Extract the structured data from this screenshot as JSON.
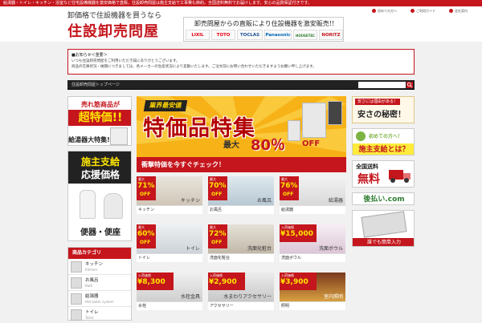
{
  "topbar": {
    "text": "給湯器・トイレ・キッチン・浴室など住宅設備機器を激安価格で直販。住設卸売問屋は施主支給で工事費も節約。全国送料無料でお届けします。安心の品質保証付きです。"
  },
  "header": {
    "tagline": "卸価格で住設機器を買うなら",
    "logo": "住設卸売問屋",
    "nav": [
      {
        "label": "初めての方へ"
      },
      {
        "label": "ご利用ガイド"
      },
      {
        "label": "会社案内"
      }
    ],
    "banner_msg": "卸売問屋からの直販により住設機器を激安販売!!",
    "brands": [
      "LIXIL",
      "TOTO",
      "TOCLAS",
      "Panasonic",
      "HOUSETEC",
      "NORITZ"
    ]
  },
  "notice": {
    "heading": "■お知らせ＜重要＞",
    "line1": "いつも住設卸売問屋をご利用いただき誠にありがとうございます。",
    "line2": "商品の在庫状況・納期につきましては、各メーカーの生産状況により変動いたします。ご注文前にお問い合わせいただきますようお願い申し上げます。"
  },
  "navbar": {
    "crumb": "住設卸売問屋トップページ",
    "search_placeholder": ""
  },
  "left_promos": {
    "p1_top": "売れ筋商品が",
    "p1_main": "超特価!!",
    "p1_sub": "給湯器大特集!",
    "p2_top": "施主支給",
    "p2_main": "応援価格",
    "p2_sub": "便器・便座"
  },
  "categories": {
    "heading": "商品カテゴリ",
    "items": [
      {
        "jp": "キッチン",
        "en": "Kitchen"
      },
      {
        "jp": "お風呂",
        "en": "Bath"
      },
      {
        "jp": "給湯器",
        "en": "Hot-water system"
      },
      {
        "jp": "トイレ",
        "en": "Toilet"
      }
    ]
  },
  "hero": {
    "badge": "業界最安値",
    "title": "特価品特集",
    "max": "最大",
    "pct": "80％",
    "off": "OFF",
    "cta": "衝撃特価を今すぐチェック！"
  },
  "tiles": [
    {
      "kicker": "最大",
      "price": "71%",
      "suffix": "OFF",
      "inlabel": "キッチン",
      "label": "キッチン"
    },
    {
      "kicker": "最大",
      "price": "70%",
      "suffix": "OFF",
      "inlabel": "お風呂",
      "label": "お風呂"
    },
    {
      "kicker": "最大",
      "price": "76%",
      "suffix": "OFF",
      "inlabel": "給湯器",
      "label": "給湯器"
    },
    {
      "kicker": "最大",
      "price": "60%",
      "suffix": "OFF",
      "inlabel": "トイレ",
      "label": "トイレ"
    },
    {
      "kicker": "最大",
      "price": "72%",
      "suffix": "OFF",
      "inlabel": "洗面化粧台",
      "label": "洗面化粧台"
    },
    {
      "kicker": "入荷価格",
      "price": "¥15,000",
      "suffix": "〜",
      "inlabel": "洗面ボウル",
      "label": "洗面ボウル"
    },
    {
      "kicker": "入荷価格",
      "price": "¥8,300",
      "suffix": "〜",
      "inlabel": "水栓金具",
      "label": "水栓"
    },
    {
      "kicker": "入荷価格",
      "price": "¥2,900",
      "suffix": "〜",
      "inlabel": "水まわりアクセサリー",
      "label": "アクセサリー"
    },
    {
      "kicker": "入荷価格",
      "price": "¥3,900",
      "suffix": "〜",
      "inlabel": "室内照明",
      "label": "照明"
    }
  ],
  "right_banners": {
    "b1_top": "安さには理由がある！",
    "b1_main": "安さの秘密！",
    "b2_top": "初めての方へ！",
    "b2_main": "施主支給とは？",
    "b3_top": "全国送料",
    "b3_main": "無料",
    "b4_main": "後払い.com",
    "b5_main": "誰でも簡単入力"
  },
  "colors": {
    "brand_red": "#c4161c",
    "accent_yellow": "#f7b217"
  }
}
